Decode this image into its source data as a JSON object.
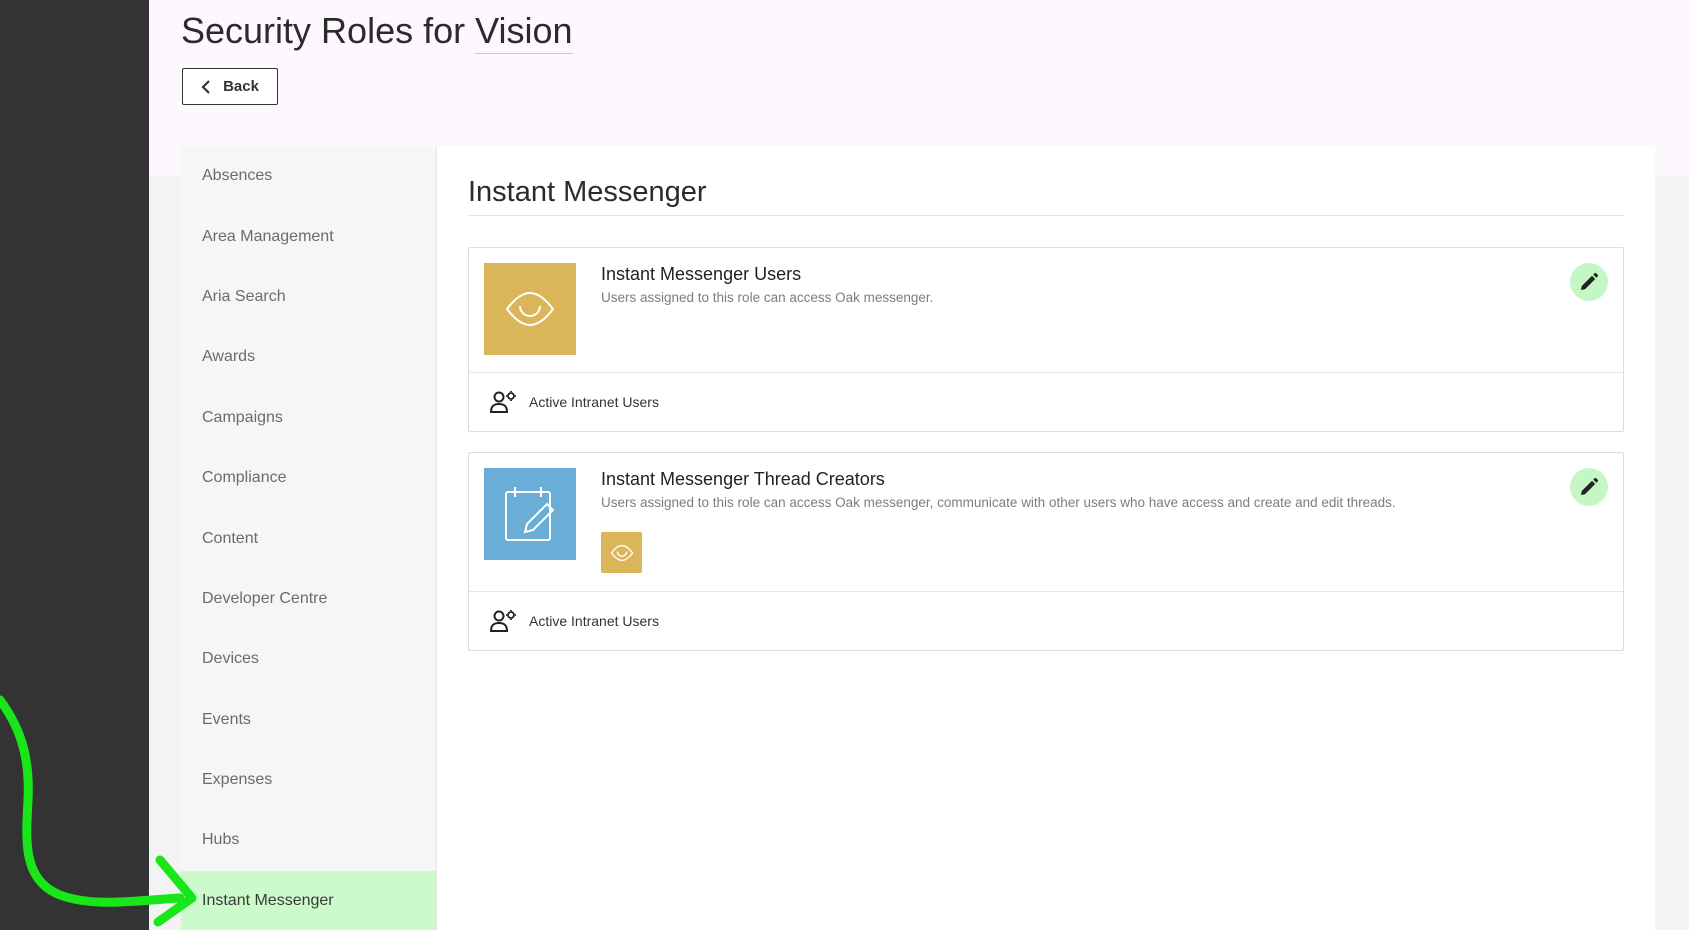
{
  "header": {
    "title_prefix": "Security Roles for",
    "title_app": "Vision",
    "back_label": "Back"
  },
  "sidebar": {
    "items": [
      {
        "label": "Absences"
      },
      {
        "label": "Area Management"
      },
      {
        "label": "Aria Search"
      },
      {
        "label": "Awards"
      },
      {
        "label": "Campaigns"
      },
      {
        "label": "Compliance"
      },
      {
        "label": "Content"
      },
      {
        "label": "Developer Centre"
      },
      {
        "label": "Devices"
      },
      {
        "label": "Events"
      },
      {
        "label": "Expenses"
      },
      {
        "label": "Hubs"
      },
      {
        "label": "Instant Messenger"
      }
    ],
    "active_label": "Instant Messenger"
  },
  "content": {
    "section_title": "Instant Messenger",
    "roles": [
      {
        "name": "Instant Messenger Users",
        "description": "Users assigned to this role can access Oak messenger.",
        "icon": "eye-icon",
        "tile_color": "#dbb55a",
        "group": "Active Intranet Users"
      },
      {
        "name": "Instant Messenger Thread Creators",
        "description": "Users assigned to this role can access Oak messenger, communicate with other users who have access and create and edit threads.",
        "icon": "calendar-edit-icon",
        "tile_color": "#6aadd6",
        "inherited_icon": "eye-icon",
        "group": "Active Intranet Users"
      }
    ]
  },
  "colors": {
    "accent_green": "#cbfacb",
    "edit_button": "#c4f7c4",
    "annotation_arrow": "#19e619"
  }
}
